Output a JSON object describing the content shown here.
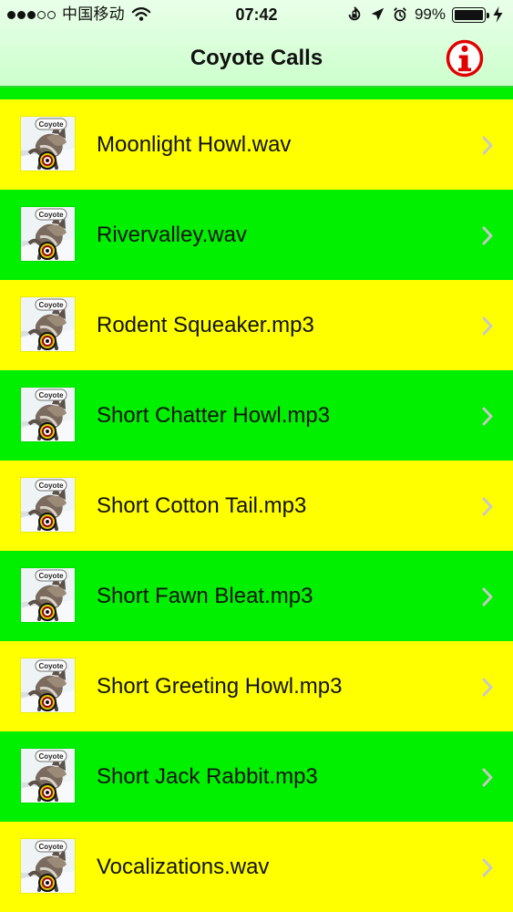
{
  "status": {
    "carrier": "中国移动",
    "time": "07:42",
    "battery_percent": "99%",
    "battery_level": 0.99,
    "icons": [
      "wifi-icon",
      "rotation-lock-icon",
      "location-arrow-icon",
      "alarm-icon",
      "battery-icon",
      "charging-icon"
    ]
  },
  "nav": {
    "title": "Coyote Calls",
    "info_icon": "info-icon",
    "info_color": "#e00000"
  },
  "thumbnail": {
    "label": "Coyote",
    "icon": "coyote-thumbnail-icon"
  },
  "colors": {
    "yellow_row": "#ffff00",
    "green_row": "#00f000",
    "chevron": "#c8c8c8"
  },
  "rows": [
    {
      "title": "Moonlight Howl.wav",
      "color": "yellow"
    },
    {
      "title": "Rivervalley.wav",
      "color": "green"
    },
    {
      "title": "Rodent Squeaker.mp3",
      "color": "yellow"
    },
    {
      "title": "Short Chatter Howl.mp3",
      "color": "green"
    },
    {
      "title": "Short Cotton Tail.mp3",
      "color": "yellow"
    },
    {
      "title": "Short Fawn Bleat.mp3",
      "color": "green"
    },
    {
      "title": "Short Greeting Howl.mp3",
      "color": "yellow"
    },
    {
      "title": "Short Jack Rabbit.mp3",
      "color": "green"
    },
    {
      "title": "Vocalizations.wav",
      "color": "yellow"
    }
  ]
}
